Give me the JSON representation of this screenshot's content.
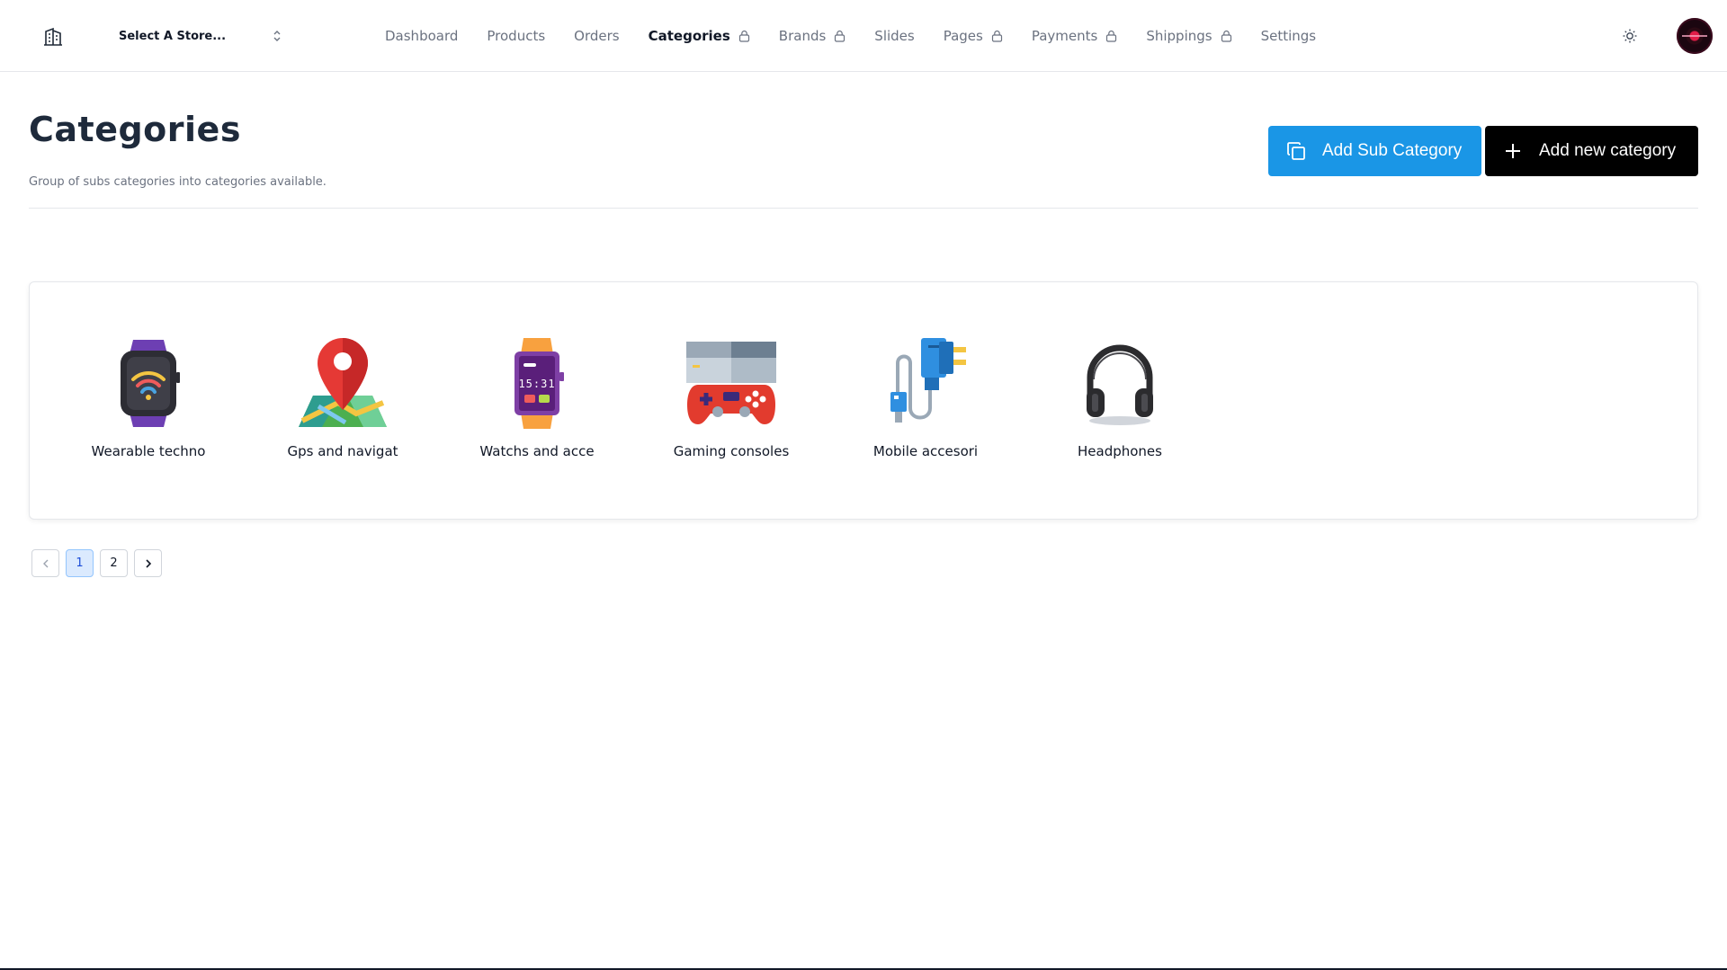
{
  "store_selector": {
    "label": "Select A Store..."
  },
  "nav": {
    "items": [
      {
        "label": "Dashboard",
        "locked": false,
        "active": false
      },
      {
        "label": "Products",
        "locked": false,
        "active": false
      },
      {
        "label": "Orders",
        "locked": false,
        "active": false
      },
      {
        "label": "Categories",
        "locked": true,
        "active": true
      },
      {
        "label": "Brands",
        "locked": true,
        "active": false
      },
      {
        "label": "Slides",
        "locked": false,
        "active": false
      },
      {
        "label": "Pages",
        "locked": true,
        "active": false
      },
      {
        "label": "Payments",
        "locked": true,
        "active": false
      },
      {
        "label": "Shippings",
        "locked": true,
        "active": false
      },
      {
        "label": "Settings",
        "locked": false,
        "active": false
      }
    ]
  },
  "header": {
    "title": "Categories",
    "subtitle": "Group of subs categories into categories available."
  },
  "actions": {
    "add_sub_category": "Add Sub Category",
    "add_new_category": "Add new category"
  },
  "categories": [
    {
      "name": "Wearable techno",
      "icon": "smartwatch-wifi-icon"
    },
    {
      "name": "Gps and navigat",
      "icon": "map-pin-icon"
    },
    {
      "name": "Watchs and acce",
      "icon": "digital-watch-icon"
    },
    {
      "name": "Gaming consoles",
      "icon": "game-console-icon"
    },
    {
      "name": "Mobile accesori",
      "icon": "charger-icon"
    },
    {
      "name": "Headphones",
      "icon": "headphones-icon"
    }
  ],
  "pagination": {
    "pages": [
      "1",
      "2"
    ],
    "current": "1"
  },
  "colors": {
    "primary": "#1a96e6",
    "dark": "#000000",
    "title": "#1e2a3b"
  }
}
